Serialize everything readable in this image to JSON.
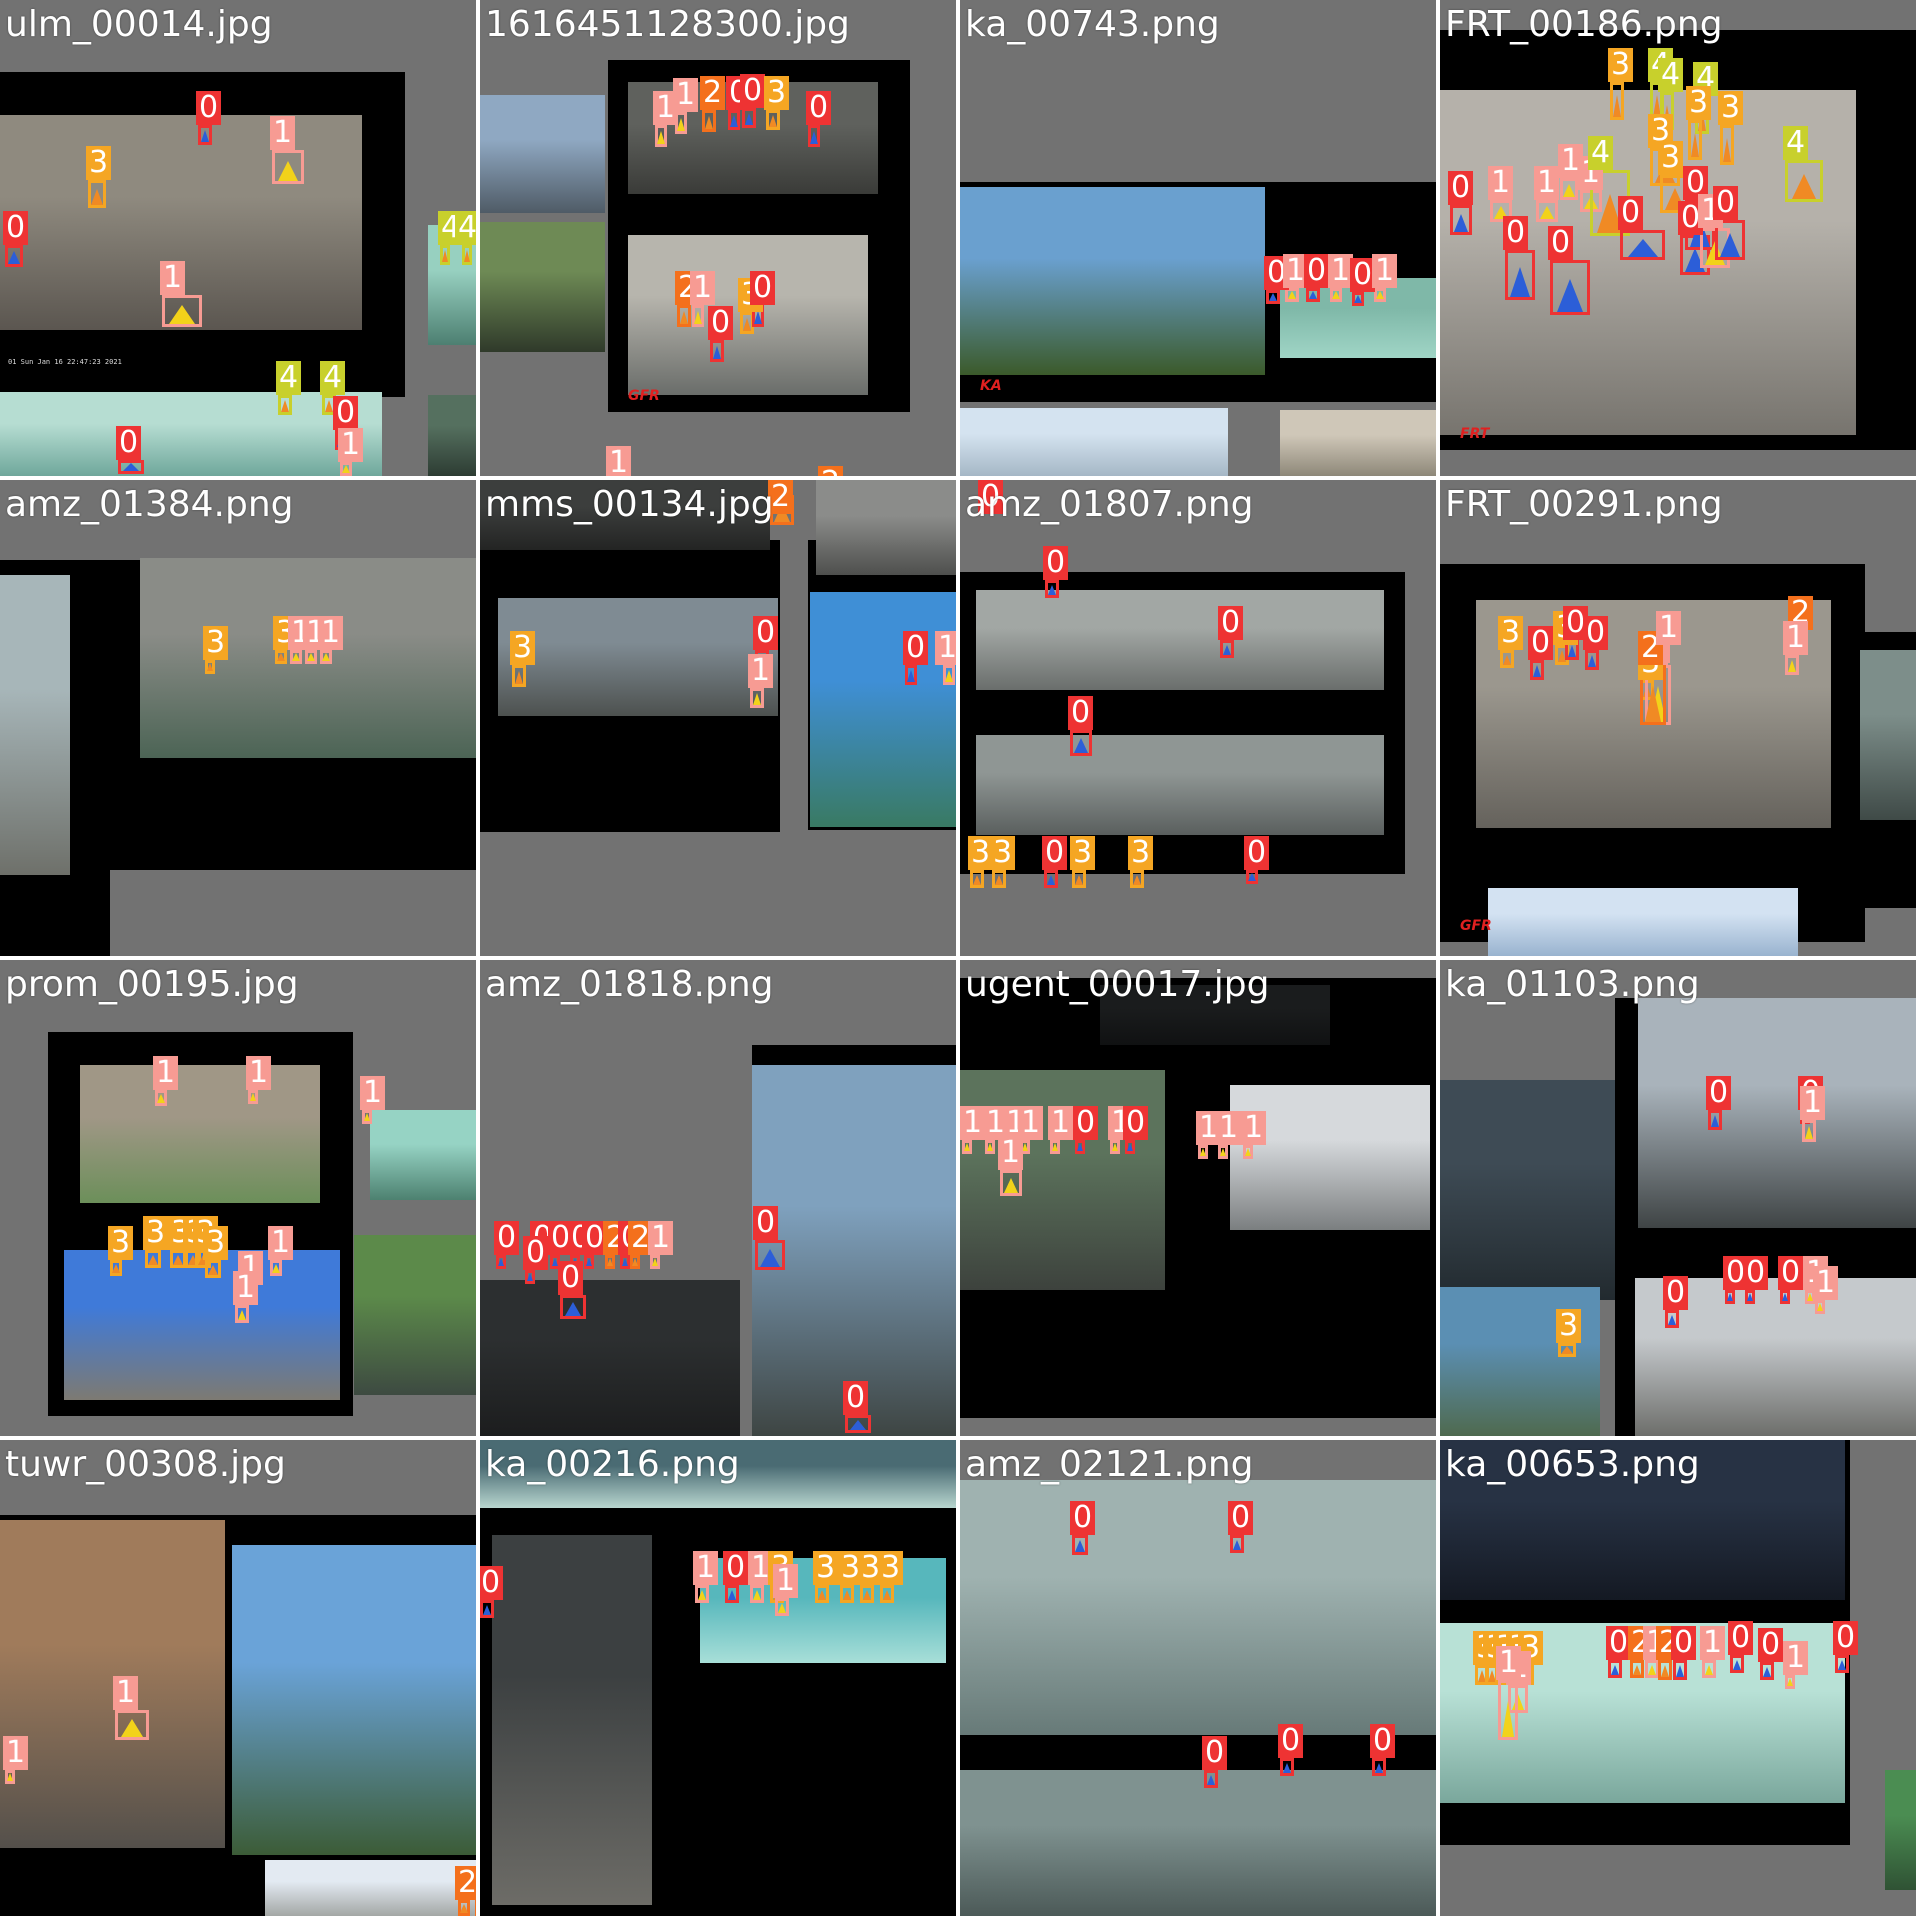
{
  "grid": {
    "columns": 4,
    "rows": 4,
    "background": "#727272",
    "separator": "#ffffff",
    "class_colors": {
      "0": "#ee3333",
      "1": "#f79b93",
      "2": "#f4701c",
      "3": "#f5a623",
      "4": "#c8d02c"
    },
    "tiles": [
      {
        "filename": "ulm_00014.jpg",
        "notes": [
          "01  Sun Jan 16 22:47:23 2021"
        ],
        "logo": "",
        "detections": [
          {
            "cls": "0"
          },
          {
            "cls": "1"
          },
          {
            "cls": "3"
          },
          {
            "cls": "0"
          },
          {
            "cls": "1"
          },
          {
            "cls": "4"
          },
          {
            "cls": "4"
          },
          {
            "cls": "4"
          },
          {
            "cls": "4"
          },
          {
            "cls": "0"
          },
          {
            "cls": "0"
          },
          {
            "cls": "1"
          }
        ]
      },
      {
        "filename": "1616451128300.jpg",
        "notes": [],
        "logo": "GFR",
        "detections": [
          {
            "cls": "1"
          },
          {
            "cls": "1"
          },
          {
            "cls": "2"
          },
          {
            "cls": "0"
          },
          {
            "cls": "0"
          },
          {
            "cls": "3"
          },
          {
            "cls": "0"
          },
          {
            "cls": "2"
          },
          {
            "cls": "1"
          },
          {
            "cls": "0"
          },
          {
            "cls": "3"
          },
          {
            "cls": "0"
          },
          {
            "cls": "1"
          },
          {
            "cls": "2"
          }
        ]
      },
      {
        "filename": "ka_00743.png",
        "notes": [],
        "logo": "KA",
        "detections": [
          {
            "cls": "0"
          },
          {
            "cls": "1"
          },
          {
            "cls": "0"
          },
          {
            "cls": "1"
          },
          {
            "cls": "0"
          },
          {
            "cls": "1"
          }
        ]
      },
      {
        "filename": "FRT_00186.png",
        "notes": [],
        "logo": "FRT",
        "detections": [
          {
            "cls": "3"
          },
          {
            "cls": "4"
          },
          {
            "cls": "4"
          },
          {
            "cls": "4"
          },
          {
            "cls": "3"
          },
          {
            "cls": "3"
          },
          {
            "cls": "1"
          },
          {
            "cls": "1"
          },
          {
            "cls": "3"
          },
          {
            "cls": "3"
          },
          {
            "cls": "4"
          },
          {
            "cls": "1"
          },
          {
            "cls": "1"
          },
          {
            "cls": "4"
          },
          {
            "cls": "0"
          },
          {
            "cls": "0"
          },
          {
            "cls": "0"
          },
          {
            "cls": "0"
          },
          {
            "cls": "0"
          },
          {
            "cls": "0"
          },
          {
            "cls": "1"
          },
          {
            "cls": "0"
          }
        ]
      },
      {
        "filename": "amz_01384.png",
        "notes": [],
        "logo": "",
        "detections": [
          {
            "cls": "3"
          },
          {
            "cls": "3"
          },
          {
            "cls": "1"
          },
          {
            "cls": "1"
          },
          {
            "cls": "1"
          }
        ]
      },
      {
        "filename": "mms_00134.jpg",
        "notes": [],
        "logo": "",
        "detections": [
          {
            "cls": "0"
          },
          {
            "cls": "1"
          },
          {
            "cls": "1"
          },
          {
            "cls": "1"
          },
          {
            "cls": "1"
          },
          {
            "cls": "0"
          },
          {
            "cls": "2"
          },
          {
            "cls": "3"
          },
          {
            "cls": "1"
          },
          {
            "cls": "0"
          },
          {
            "cls": "1"
          },
          {
            "cls": "1"
          }
        ]
      },
      {
        "filename": "amz_01807.png",
        "notes": [],
        "logo": "",
        "detections": [
          {
            "cls": "0"
          },
          {
            "cls": "0"
          },
          {
            "cls": "0"
          },
          {
            "cls": "0"
          },
          {
            "cls": "3"
          },
          {
            "cls": "3"
          },
          {
            "cls": "0"
          },
          {
            "cls": "3"
          },
          {
            "cls": "3"
          },
          {
            "cls": "0"
          }
        ]
      },
      {
        "filename": "FRT_00291.png",
        "notes": [],
        "logo": "GFR",
        "detections": [
          {
            "cls": "3"
          },
          {
            "cls": "0"
          },
          {
            "cls": "3"
          },
          {
            "cls": "0"
          },
          {
            "cls": "0"
          },
          {
            "cls": "3"
          },
          {
            "cls": "1"
          },
          {
            "cls": "2"
          },
          {
            "cls": "1"
          },
          {
            "cls": "2"
          },
          {
            "cls": "1"
          }
        ]
      },
      {
        "filename": "prom_00195.jpg",
        "notes": [],
        "logo": "",
        "detections": [
          {
            "cls": "1"
          },
          {
            "cls": "1"
          },
          {
            "cls": "1"
          },
          {
            "cls": "3"
          },
          {
            "cls": "3"
          },
          {
            "cls": "3"
          },
          {
            "cls": "3"
          },
          {
            "cls": "3"
          },
          {
            "cls": "3"
          },
          {
            "cls": "1"
          },
          {
            "cls": "1"
          },
          {
            "cls": "1"
          }
        ]
      },
      {
        "filename": "amz_01818.png",
        "notes": [],
        "logo": "",
        "detections": [
          {
            "cls": "0"
          },
          {
            "cls": "0"
          },
          {
            "cls": "0"
          },
          {
            "cls": "0"
          },
          {
            "cls": "0"
          },
          {
            "cls": "2"
          },
          {
            "cls": "0"
          },
          {
            "cls": "2"
          },
          {
            "cls": "1"
          },
          {
            "cls": "0"
          },
          {
            "cls": "0"
          },
          {
            "cls": "0"
          },
          {
            "cls": "0"
          }
        ]
      },
      {
        "filename": "ugent_00017.jpg",
        "notes": [],
        "logo": "",
        "detections": [
          {
            "cls": "1"
          },
          {
            "cls": "1"
          },
          {
            "cls": "1"
          },
          {
            "cls": "1"
          },
          {
            "cls": "1"
          },
          {
            "cls": "0"
          },
          {
            "cls": "1"
          },
          {
            "cls": "0"
          },
          {
            "cls": "1"
          },
          {
            "cls": "1"
          },
          {
            "cls": "1"
          },
          {
            "cls": "1"
          }
        ]
      },
      {
        "filename": "ka_01103.png",
        "notes": [],
        "logo": "",
        "detections": [
          {
            "cls": "0"
          },
          {
            "cls": "0"
          },
          {
            "cls": "1"
          },
          {
            "cls": "3"
          },
          {
            "cls": "0"
          },
          {
            "cls": "0"
          },
          {
            "cls": "0"
          },
          {
            "cls": "0"
          },
          {
            "cls": "1"
          },
          {
            "cls": "1"
          }
        ]
      },
      {
        "filename": "tuwr_00308.jpg",
        "notes": [],
        "logo": "",
        "detections": [
          {
            "cls": "1"
          },
          {
            "cls": "1"
          },
          {
            "cls": "2"
          },
          {
            "cls": "2"
          }
        ]
      },
      {
        "filename": "ka_00216.png",
        "notes": [],
        "logo": "",
        "detections": [
          {
            "cls": "1"
          },
          {
            "cls": "0"
          },
          {
            "cls": "1"
          },
          {
            "cls": "3"
          },
          {
            "cls": "1"
          },
          {
            "cls": "3"
          },
          {
            "cls": "3"
          },
          {
            "cls": "3"
          },
          {
            "cls": "3"
          },
          {
            "cls": "0"
          }
        ]
      },
      {
        "filename": "amz_02121.png",
        "notes": [],
        "logo": "",
        "detections": [
          {
            "cls": "0"
          },
          {
            "cls": "0"
          },
          {
            "cls": "0"
          },
          {
            "cls": "0"
          },
          {
            "cls": "0"
          }
        ]
      },
      {
        "filename": "ka_00653.png",
        "notes": [],
        "logo": "",
        "detections": [
          {
            "cls": "3"
          },
          {
            "cls": "3"
          },
          {
            "cls": "3"
          },
          {
            "cls": "3"
          },
          {
            "cls": "3"
          },
          {
            "cls": "1"
          },
          {
            "cls": "1"
          },
          {
            "cls": "0"
          },
          {
            "cls": "2"
          },
          {
            "cls": "1"
          },
          {
            "cls": "2"
          },
          {
            "cls": "0"
          },
          {
            "cls": "1"
          },
          {
            "cls": "0"
          },
          {
            "cls": "0"
          },
          {
            "cls": "1"
          },
          {
            "cls": "0"
          }
        ]
      }
    ]
  }
}
